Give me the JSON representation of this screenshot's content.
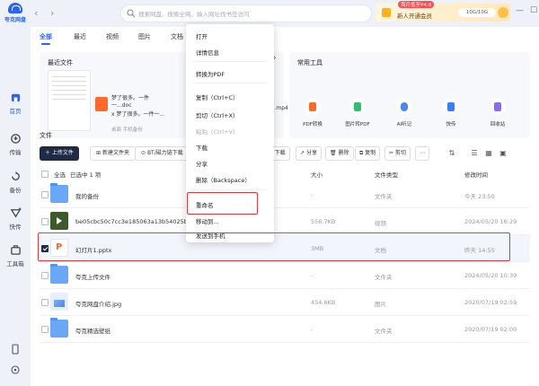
{
  "app": {
    "logo_text": "夸克网盘"
  },
  "sidebar": {
    "items": [
      {
        "label": "首页",
        "icon": "home-icon"
      },
      {
        "label": "传输",
        "icon": "transfer-icon"
      },
      {
        "label": "备份",
        "icon": "backup-icon"
      },
      {
        "label": "快传",
        "icon": "quick-send-icon"
      },
      {
        "label": "工具箱",
        "icon": "toolbox-icon"
      }
    ]
  },
  "topbar": {
    "search_placeholder": "搜索网盘、搜索全网、输入网址找书签访问",
    "promo_badge": "首月低至¥4.8",
    "promo_title": "新人开通会员",
    "quota": "10G/10G"
  },
  "tabs": [
    "全部",
    "最近",
    "视频",
    "图片",
    "文档"
  ],
  "recent": {
    "title": "最近文件",
    "items": [
      {
        "name": "梦了很多。一件一...doc",
        "sub": ""
      },
      {
        "name": "x 梦了很多。一件一...",
        "sub": "桌面  手机备份"
      },
      {
        "name": "",
        "sub": ""
      }
    ],
    "mp4": "5b4.mp4"
  },
  "tools": {
    "title": "常用工具",
    "items": [
      {
        "label": "PDF转换",
        "color": "#ff6a2a"
      },
      {
        "label": "图片转PDF",
        "color": "#2fbf71"
      },
      {
        "label": "AI听记",
        "color": "#4a86e8"
      },
      {
        "label": "快传",
        "color": "#3b7cf5"
      },
      {
        "label": "回收站",
        "color": "#8e6be8"
      }
    ]
  },
  "files": {
    "title": "文件",
    "upload": "上传文件",
    "new_folder": "新建文件夹",
    "bt": "BT/磁力链下载",
    "toolbar": [
      "下载",
      "分享",
      "删除",
      "复制",
      "剪切"
    ],
    "select_all": "全选",
    "selected": "已选中 1 项",
    "columns": {
      "size": "大小",
      "type": "文件类型",
      "modified": "修改时间"
    },
    "rows": [
      {
        "name": "我的备份",
        "size": "-",
        "type": "文件夹",
        "modified": "今天 23:50",
        "kind": "folder"
      },
      {
        "name": "be05cbc50c7cc3e185063a13b54025b4.mp4",
        "size": "556.7KB",
        "type": "视频",
        "modified": "2024/05/20 16:29",
        "kind": "video"
      },
      {
        "name": "幻灯片1.pptx",
        "size": "3MB",
        "type": "文档",
        "modified": "昨天 14:55",
        "kind": "ppt",
        "selected": true
      },
      {
        "name": "夸克上传文件",
        "size": "-",
        "type": "文件夹",
        "modified": "2024/05/20 10:39",
        "kind": "folder"
      },
      {
        "name": "夸克网盘介绍.jpg",
        "size": "454.6KB",
        "type": "图片",
        "modified": "2020/07/19 02:59",
        "kind": "image"
      },
      {
        "name": "夸克精选壁纸",
        "size": "-",
        "type": "文件夹",
        "modified": "2020/07/19 02:00",
        "kind": "folder"
      }
    ]
  },
  "context_menu": {
    "items": [
      {
        "label": "打开",
        "disabled": false
      },
      {
        "label": "详情信息",
        "disabled": false
      },
      {
        "label": "转换为PDF",
        "disabled": false
      },
      {
        "label": "复制（Ctrl+C）",
        "disabled": false
      },
      {
        "label": "剪切（Ctrl+X）",
        "disabled": false
      },
      {
        "label": "粘贴（Ctrl+V）",
        "disabled": true
      },
      {
        "label": "下载",
        "disabled": false
      },
      {
        "label": "分享",
        "disabled": false
      },
      {
        "label": "删除（Backspace）",
        "disabled": false
      },
      {
        "label": "重命名",
        "disabled": false
      },
      {
        "label": "移动到...",
        "disabled": false
      },
      {
        "label": "发送到手机",
        "disabled": false
      }
    ]
  },
  "colors": {
    "accent": "#2a64f5",
    "dark_button": "#1f2a44",
    "highlight": "#e03a3a"
  }
}
